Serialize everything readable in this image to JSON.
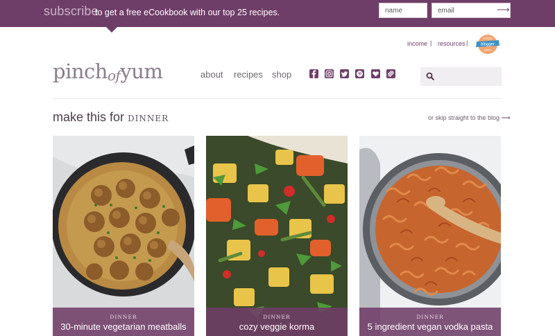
{
  "subscribe": {
    "word": "subscribe",
    "text": "to get a free eCookbook with our top 25 recipes.",
    "name_placeholder": "name",
    "email_placeholder": "email",
    "submit_icon": "arrow-right-icon"
  },
  "utility_links": [
    "income",
    "resources"
  ],
  "utility_separator": "|",
  "badge": {
    "line1": "FOOD",
    "line2": "blogger",
    "line3": "PRO"
  },
  "logo": {
    "part1": "pinch",
    "part2": "of",
    "part3": "yum"
  },
  "nav": [
    "about",
    "recipes",
    "shop"
  ],
  "social_icons": [
    "facebook-icon",
    "instagram-icon",
    "twitter-icon",
    "pinterest-icon",
    "bloglovin-icon",
    "yummly-icon"
  ],
  "search": {
    "placeholder": ""
  },
  "section": {
    "lead": "make this for",
    "meal": "DINNER"
  },
  "skip_link": {
    "text": "or skip straight to the blog",
    "arrow": "⟶"
  },
  "cards": [
    {
      "category": "DINNER",
      "title": "30-minute vegetarian meatballs"
    },
    {
      "category": "DINNER",
      "title": "cozy veggie korma"
    },
    {
      "category": "DINNER",
      "title": "5 ingredient vegan vodka pasta"
    }
  ],
  "colors": {
    "brand": "#6f3e68",
    "text": "#5e5660"
  }
}
